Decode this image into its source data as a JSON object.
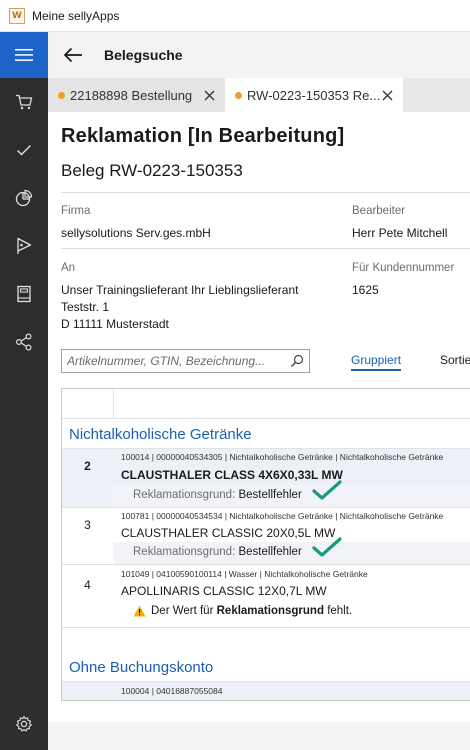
{
  "window": {
    "title": "Meine sellyApps",
    "app_icon_glyph": "W"
  },
  "sidebar": {
    "accent": "#1e64c8",
    "items": [
      {
        "icon": "cart-icon"
      },
      {
        "icon": "check-icon"
      },
      {
        "icon": "pie-chart-icon"
      },
      {
        "icon": "tag-icon"
      },
      {
        "icon": "book-icon"
      },
      {
        "icon": "network-icon"
      }
    ],
    "bottom_icon": "gear-icon"
  },
  "header": {
    "title": "Belegsuche"
  },
  "tabs": [
    {
      "label": "22188898 Bestellung",
      "modified": true
    },
    {
      "label": "RW-0223-150353 Re...",
      "modified": true,
      "active": true
    }
  ],
  "document": {
    "title": "Reklamation [In Bearbeitung]",
    "subtitle": "Beleg RW-0223-150353",
    "firma_label": "Firma",
    "firma_value": "sellysolutions Serv.ges.mbH",
    "bearbeiter_label": "Bearbeiter",
    "bearbeiter_value": "Herr Pete Mitchell",
    "an_label": "An",
    "an_lines": [
      "Unser Trainingslieferant Ihr Lieblingslieferant",
      "Teststr. 1",
      "D 11111 Musterstadt"
    ],
    "kunden_label": "Für Kundennummer",
    "kunden_value": "1625"
  },
  "search": {
    "placeholder": "Artikelnummer, GTIN, Bezeichnung..."
  },
  "view_tabs": {
    "grouped": "Gruppiert",
    "sort": "Sortie"
  },
  "groups": [
    {
      "title": "Nichtalkoholische Getränke",
      "rows": [
        {
          "pos": "2",
          "meta": "100014 | 00000040534305 | Nichtalkoholische Getränke | Nichtalkoholische Getränke",
          "name": "CLAUSTHALER CLASS 4X6X0,33L MW",
          "reason_label": "Reklamationsgrund:",
          "reason_value": "Bestellfehler"
        },
        {
          "pos": "3",
          "meta": "100781 | 00000040534534 | Nichtalkoholische Getränke | Nichtalkoholische Getränke",
          "name": "CLAUSTHALER CLASSIC 20X0,5L MW",
          "reason_label": "Reklamationsgrund:",
          "reason_value": "Bestellfehler"
        },
        {
          "pos": "4",
          "meta": "101049 | 04100590100114 | Wasser | Nichtalkoholische Getränke",
          "name": "APOLLINARIS CLASSIC 12X0,7L MW",
          "warning_prefix": "Der Wert für",
          "warning_field": "Reklamationsgrund",
          "warning_suffix": "fehlt."
        }
      ]
    },
    {
      "title": "Ohne Buchungskonto",
      "rows": [
        {
          "meta": "100004 | 04016887055084"
        }
      ]
    }
  ],
  "colors": {
    "link": "#1a5fb4",
    "check": "#1a9a7a",
    "warning": "#f0b400",
    "modified_dot": "#f0a020"
  }
}
